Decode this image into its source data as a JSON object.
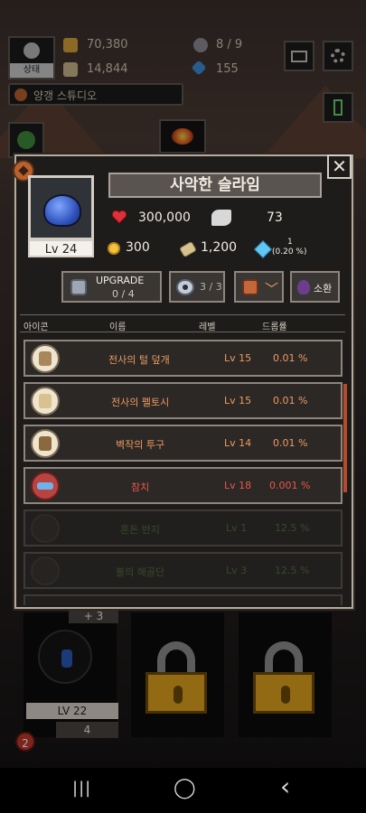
{
  "hud": {
    "profile_label": "상태",
    "gold": "70,380",
    "scrolls": "14,844",
    "eyes": "8 / 9",
    "gems": "155",
    "studio": "양갱 스튜디오"
  },
  "monster": {
    "name": "사악한 슬라임",
    "level": "Lv 24",
    "hp": "300,000",
    "attack": "73",
    "gold": "300",
    "scroll": "1,200",
    "gem": "1",
    "gem_chance": "(0.20 %)"
  },
  "buttons": {
    "upgrade": "UPGRADE",
    "upgrade_count": "0 / 4",
    "eye_count": "3 / 3",
    "drop_chevron": "﹀",
    "summon": "소환",
    "close": "✕"
  },
  "table": {
    "headers": [
      "아이콘",
      "이름",
      "레벨",
      "드롭률"
    ],
    "rows": [
      {
        "name": "전사의 털 덮개",
        "level": "Lv 15",
        "rate": "0.01 %"
      },
      {
        "name": "전사의 펠토시",
        "level": "Lv 15",
        "rate": "0.01 %"
      },
      {
        "name": "벽작의 투구",
        "level": "Lv 14",
        "rate": "0.01 %"
      },
      {
        "name": "참치",
        "level": "Lv 18",
        "rate": "0.001 %"
      },
      {
        "name": "혼돈 반지",
        "level": "Lv 1",
        "rate": "12.5 %"
      },
      {
        "name": "불의 해골단",
        "level": "Lv 3",
        "rate": "12.5 %"
      }
    ]
  },
  "hero": {
    "plus": "+ 3",
    "level": "LV 22",
    "count": "4",
    "badge": "2"
  },
  "nav": {
    "recent": "|||",
    "home": "◯",
    "back": "‹"
  }
}
